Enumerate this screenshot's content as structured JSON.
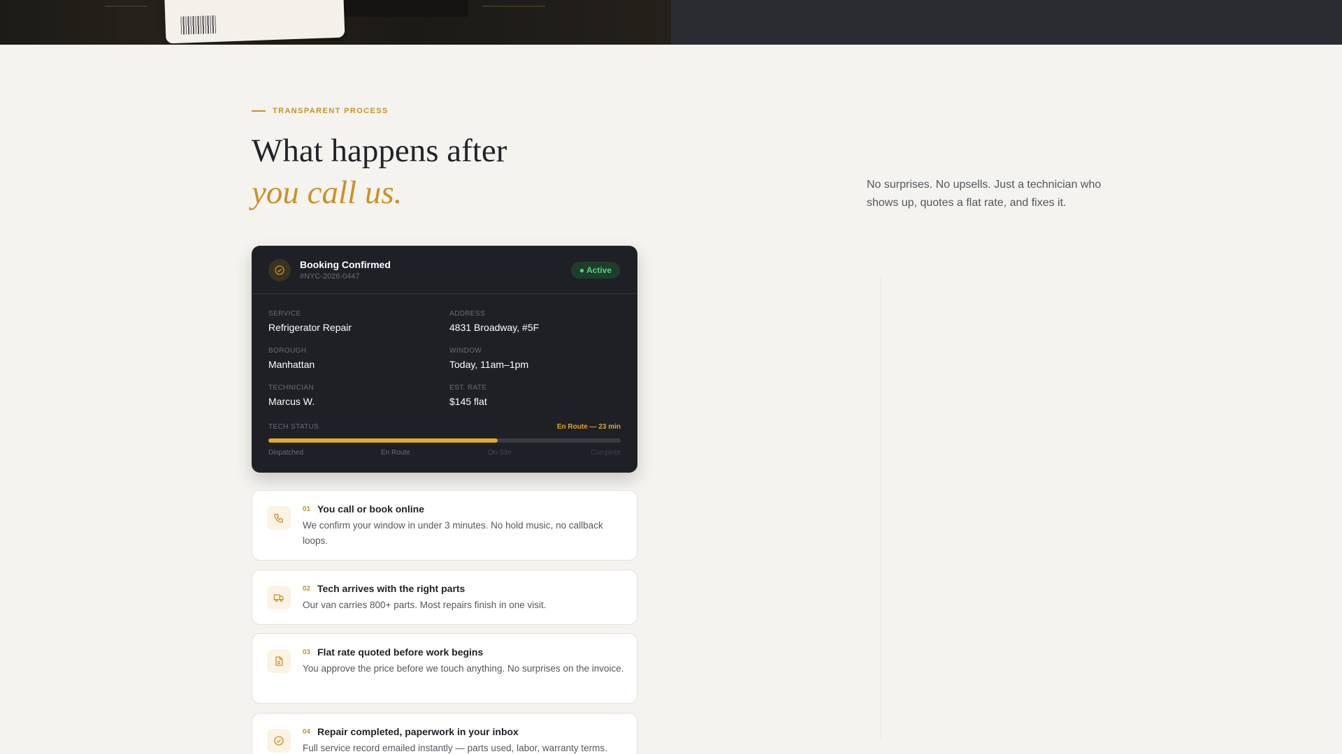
{
  "section": {
    "eyebrow": "TRANSPARENT PROCESS",
    "headline_line1": "What happens after",
    "headline_line2": "you call us.",
    "intro": "No surprises. No upsells. Just a technician who shows up, quotes a flat rate, and fixes it."
  },
  "booking": {
    "title": "Booking Confirmed",
    "id": "#NYC-2026-0447",
    "status_badge": "● Active",
    "fields": {
      "service_label": "SERVICE",
      "service": "Refrigerator Repair",
      "address_label": "ADDRESS",
      "address": "4831 Broadway, #5F",
      "borough_label": "BOROUGH",
      "borough": "Manhattan",
      "window_label": "WINDOW",
      "window": "Today, 11am–1pm",
      "technician_label": "TECHNICIAN",
      "technician": "Marcus W.",
      "rate_label": "EST. RATE",
      "rate": "$145 flat"
    },
    "tech_status_label": "TECH STATUS",
    "tech_status_eta": "En Route — 23 min",
    "progress_fraction": 0.65,
    "stages": [
      "Dispatched",
      "En Route",
      "On-Site",
      "Complete"
    ]
  },
  "steps": [
    {
      "num": "01",
      "title": "You call or book online",
      "desc": "We confirm your window in under 3 minutes. No hold music, no callback loops.",
      "icon": "phone-icon"
    },
    {
      "num": "02",
      "title": "Tech arrives with the right parts",
      "desc": "Our van carries 800+ parts. Most repairs finish in one visit.",
      "icon": "truck-icon"
    },
    {
      "num": "03",
      "title": "Flat rate quoted before work begins",
      "desc": "You approve the price before we touch anything. No surprises on the invoice.",
      "icon": "document-icon"
    },
    {
      "num": "04",
      "title": "Repair completed, paperwork in your inbox",
      "desc": "Full service record emailed instantly — parts used, labor, warranty terms.",
      "icon": "check-circle-icon"
    }
  ],
  "colors": {
    "accent": "#c9922a",
    "card_bg": "#1f2025",
    "active_green": "#4fd67c"
  }
}
